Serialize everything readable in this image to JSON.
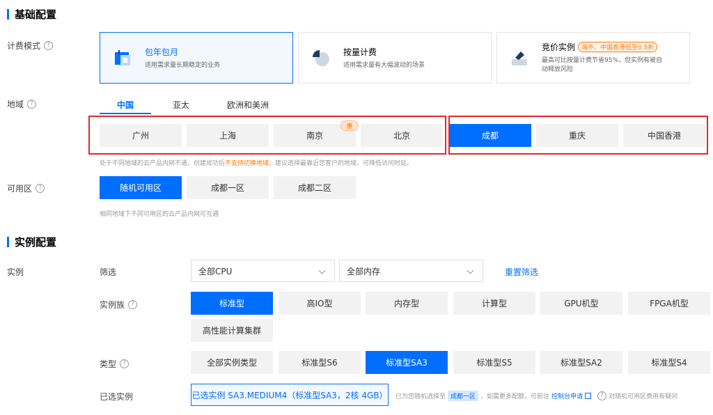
{
  "basic_section": {
    "title": "基础配置"
  },
  "billing": {
    "label": "计费模式",
    "cards": [
      {
        "title": "包年包月",
        "desc": "适用需求量长期稳定的业务",
        "selected": true,
        "icon": "calendar-icon"
      },
      {
        "title": "按量计费",
        "desc": "适用需求量有大幅波动的场景",
        "selected": false,
        "icon": "pie-chart-icon"
      },
      {
        "title": "竞价实例",
        "promo": "海外、中国香港低至0.5折",
        "desc_line1": "最高可比按量计费节省95%，但实例有被自",
        "desc_line2": "动释放风险",
        "selected": false,
        "icon": "auction-hammer-icon"
      }
    ]
  },
  "region": {
    "label": "地域",
    "tabs": [
      "中国",
      "亚太",
      "欧洲和美洲"
    ],
    "active_tab": "中国",
    "options": [
      "广州",
      "上海",
      "南京",
      "北京",
      "成都",
      "重庆",
      "中国香港"
    ],
    "selected": "成都",
    "badge": "惠",
    "hint_prefix": "处于不同地域的云产品内网不通，创建成功后",
    "hint_warning": "不支持切换地域",
    "hint_suffix": "；建议选择最靠近您客户的地域，可降低访问时延。"
  },
  "zone": {
    "label": "可用区",
    "options": [
      "随机可用区",
      "成都一区",
      "成都二区"
    ],
    "selected": "随机可用区",
    "hint": "相同地域下不同可用区的云产品内网可互通"
  },
  "instance_section": {
    "title": "实例配置"
  },
  "instance": {
    "label": "实例",
    "filter_label": "筛选",
    "cpu_select": "全部CPU",
    "mem_select": "全部内存",
    "reset_link": "重置筛选",
    "family_label": "实例族",
    "families": [
      "标准型",
      "高IO型",
      "内存型",
      "计算型",
      "GPU机型",
      "FPGA机型",
      "高性能计算集群"
    ],
    "family_selected": "标准型",
    "type_label": "类型",
    "types": [
      "全部实例类型",
      "标准型S6",
      "标准型SA3",
      "标准型S5",
      "标准型SA2",
      "标准型S4"
    ],
    "type_selected": "标准型SA3",
    "chosen_label": "已选实例",
    "chosen_value": "已选实例 SA3.MEDIUM4（标准型SA3，2核 4GB）",
    "note_prefix": "已为您随机选择至",
    "note_zone": "成都一区",
    "note_middle": "，如需更多配额，可前往",
    "note_link": "控制台申请",
    "note_help": "对随机可用区费用有疑问"
  },
  "colors": {
    "accent": "#006eff",
    "warning": "#ff7200",
    "highlight_box": "#e6252b"
  }
}
